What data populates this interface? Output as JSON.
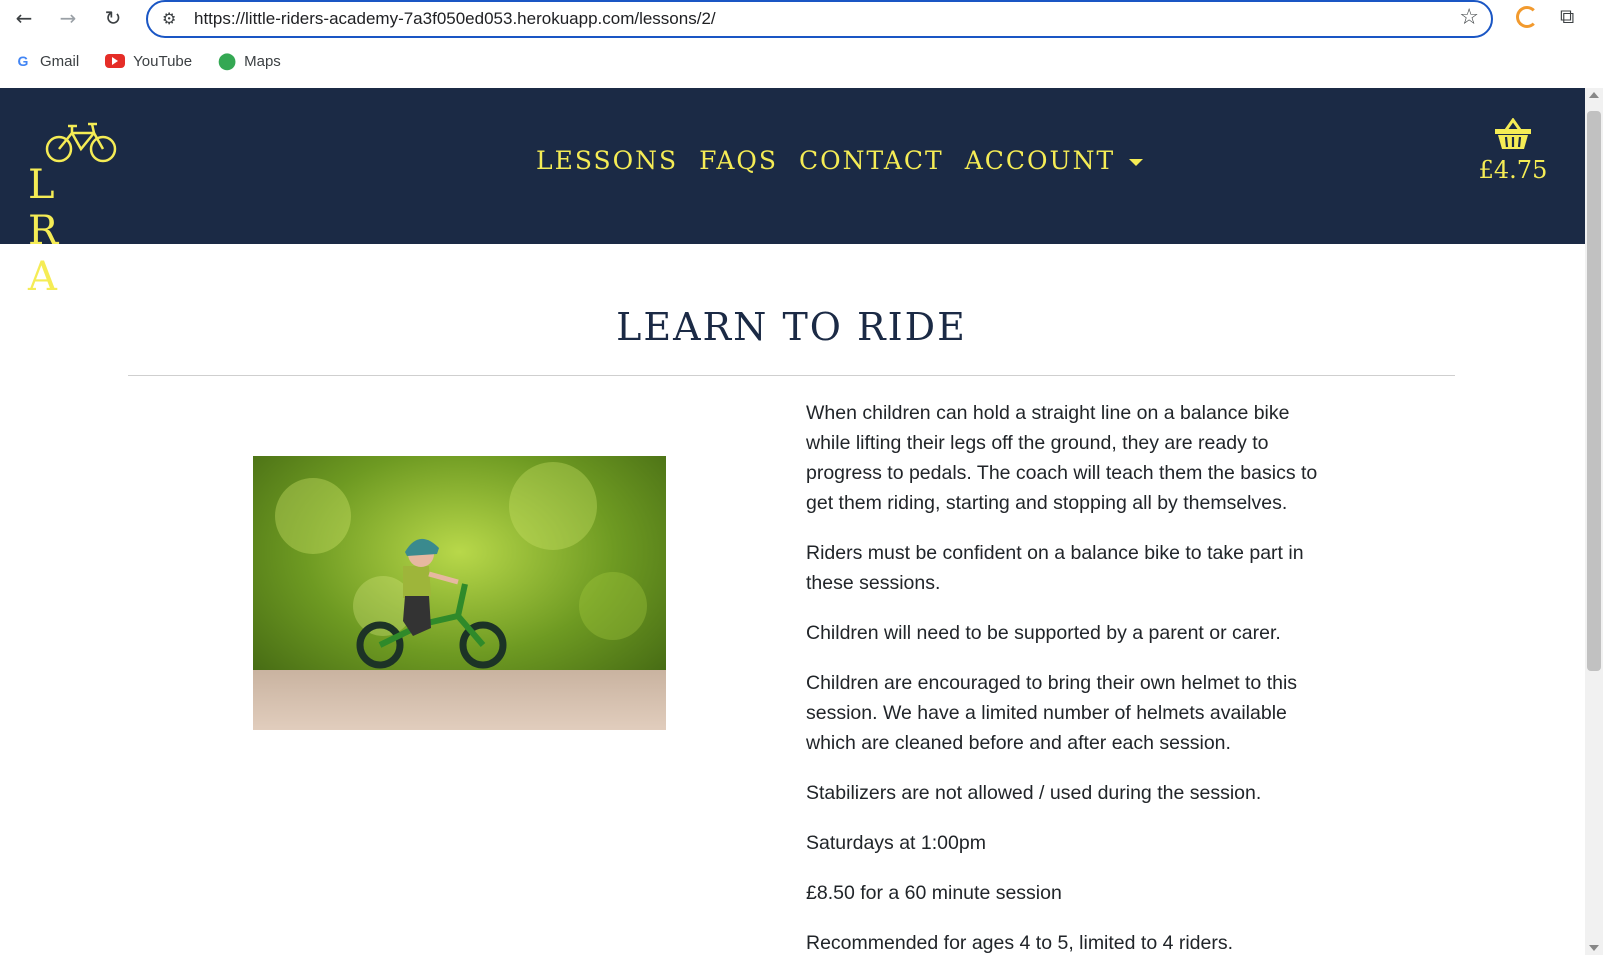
{
  "browser": {
    "url": "https://little-riders-academy-7a3f050ed053.herokuapp.com/lessons/2/",
    "bookmarks": [
      {
        "label": "Gmail",
        "icon": "google-icon"
      },
      {
        "label": "YouTube",
        "icon": "youtube-icon"
      },
      {
        "label": "Maps",
        "icon": "maps-icon"
      }
    ]
  },
  "header": {
    "logo_text": "L R A",
    "nav": {
      "lessons": "LESSONS",
      "faqs": "FAQS",
      "contact": "CONTACT",
      "account": "ACCOUNT"
    },
    "basket_total": "£4.75"
  },
  "main": {
    "title": "LEARN TO RIDE",
    "paragraphs": [
      "When children can hold a straight line on a balance bike while lifting their legs off the ground, they are ready to progress to pedals. The coach will teach them the basics to get them riding, starting and stopping all by themselves.",
      "Riders must be confident on a balance bike to take part in these sessions.",
      "Children will need to be supported by a parent or carer.",
      "Children are encouraged to bring their own helmet to this session. We have a limited number of helmets available which are cleaned before and after each session.",
      "Stabilizers are not allowed / used during the session.",
      "Saturdays at 1:00pm",
      "£8.50 for a 60 minute session",
      "Recommended for ages 4 to 5, limited to 4 riders."
    ]
  },
  "colors": {
    "header_bg": "#1b2a45",
    "accent": "#f5ec55",
    "title": "#1b2a45",
    "body_text": "#212529"
  }
}
